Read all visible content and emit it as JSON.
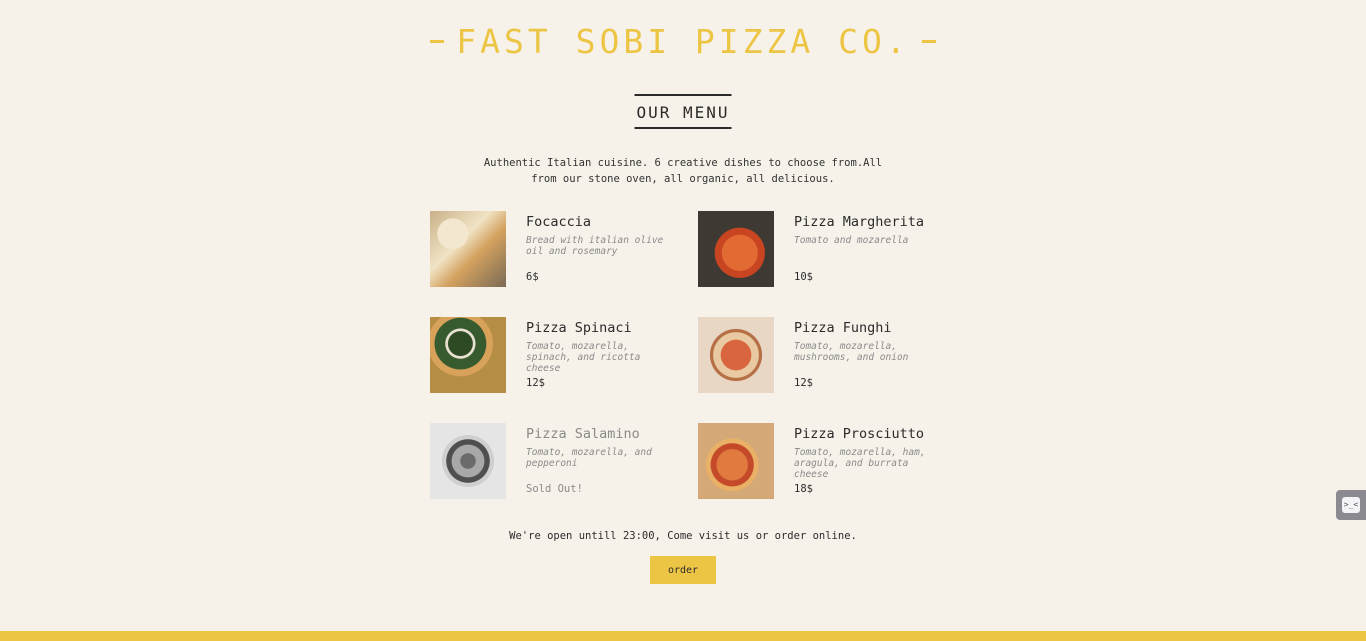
{
  "header": {
    "brand": "FAST SOBI PIZZA CO.",
    "menu_title": "OUR MENU",
    "intro": "Authentic Italian cuisine. 6 creative dishes to choose from.All from our stone oven, all organic, all delicious."
  },
  "items": [
    {
      "name": "Focaccia",
      "desc": "Bread with italian olive oil and rosemary",
      "price": "6$"
    },
    {
      "name": "Pizza Margherita",
      "desc": "Tomato and mozarella",
      "price": "10$"
    },
    {
      "name": "Pizza Spinaci",
      "desc": "Tomato, mozarella, spinach, and ricotta cheese",
      "price": "12$"
    },
    {
      "name": "Pizza Funghi",
      "desc": "Tomato, mozarella, mushrooms, and onion",
      "price": "12$"
    },
    {
      "name": "Pizza Salamino",
      "desc": "Tomato, mozarella, and pepperoni",
      "price": "Sold Out!"
    },
    {
      "name": "Pizza Prosciutto",
      "desc": "Tomato, mozarella, ham, aragula, and burrata cheese",
      "price": "18$"
    }
  ],
  "footer": {
    "open_text": "We're open untill 23:00, Come visit us or order online.",
    "order_label": "order"
  },
  "widget": {
    "label": ">_<"
  },
  "colors": {
    "accent": "#edc545",
    "background": "#f6f2ea",
    "text": "#2b2b2b",
    "muted": "#8a8a8a"
  }
}
